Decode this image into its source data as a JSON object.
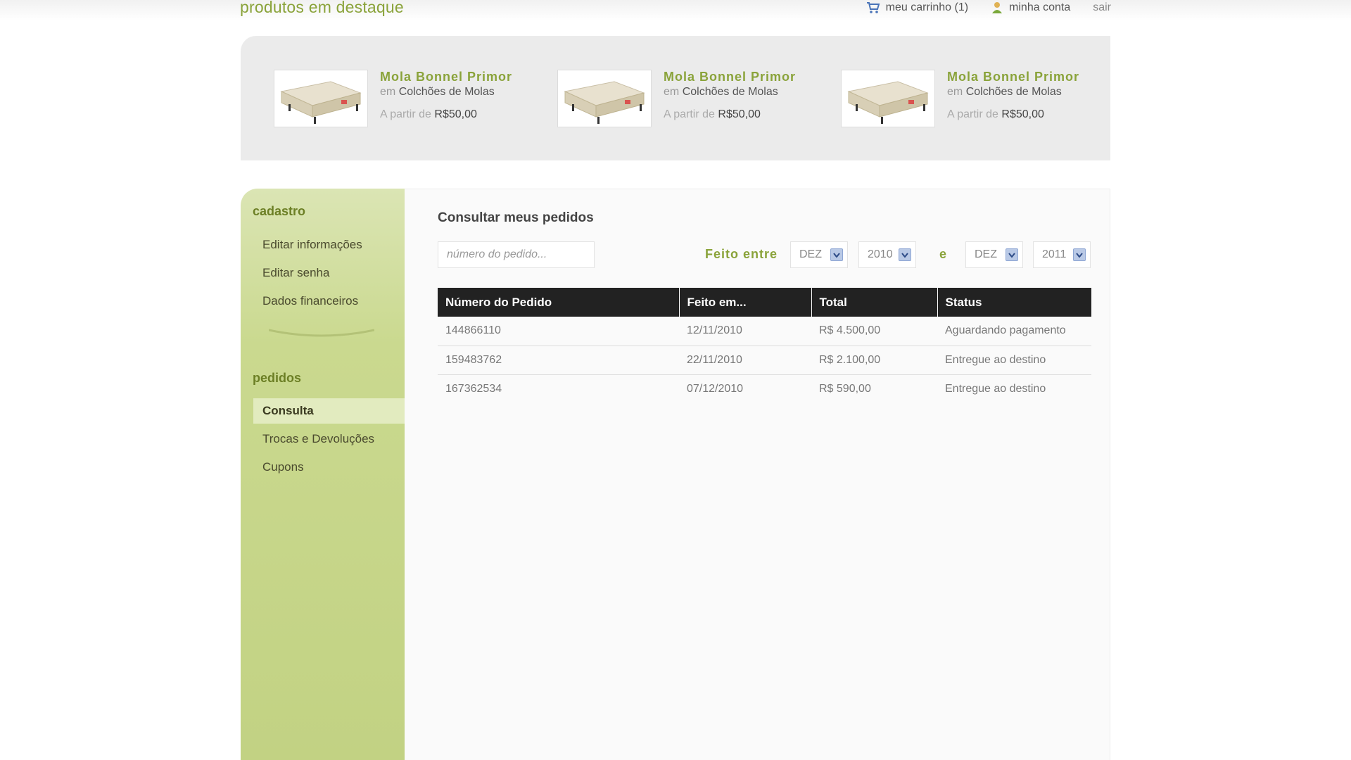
{
  "header": {
    "section_title": "produtos em destaque",
    "cart_label": "meu carrinho (1)",
    "account_label": "minha conta",
    "logout_label": "sair"
  },
  "featured": {
    "products": [
      {
        "name": "Mola Bonnel Primor",
        "cat_prefix": "em",
        "category": "Colchões de Molas",
        "price_prefix": "A partir de",
        "price": "R$50,00"
      },
      {
        "name": "Mola Bonnel Primor",
        "cat_prefix": "em",
        "category": "Colchões de Molas",
        "price_prefix": "A partir de",
        "price": "R$50,00"
      },
      {
        "name": "Mola Bonnel Primor",
        "cat_prefix": "em",
        "category": "Colchões de Molas",
        "price_prefix": "A partir de",
        "price": "R$50,00"
      }
    ]
  },
  "sidebar": {
    "cadastro_title": "cadastro",
    "cadastro_items": [
      "Editar informações",
      "Editar senha",
      "Dados financeiros"
    ],
    "pedidos_title": "pedidos",
    "pedidos_items": [
      "Consulta",
      "Trocas e Devoluções",
      "Cupons"
    ],
    "active_item": "Consulta"
  },
  "main": {
    "title": "Consultar meus pedidos",
    "search_placeholder": "número do pedido...",
    "filter_label": "Feito entre",
    "filter_connector": "e",
    "from_month": "DEZ",
    "from_year": "2010",
    "to_month": "DEZ",
    "to_year": "2011",
    "table": {
      "headers": [
        "Número do Pedido",
        "Feito em...",
        "Total",
        "Status"
      ],
      "rows": [
        [
          "144866110",
          "12/11/2010",
          "R$ 4.500,00",
          "Aguardando pagamento"
        ],
        [
          "159483762",
          "22/11/2010",
          "R$ 2.100,00",
          "Entregue ao destino"
        ],
        [
          "167362534",
          "07/12/2010",
          "R$ 590,00",
          "Entregue ao destino"
        ]
      ]
    }
  },
  "colors": {
    "accent_green": "#8aa33a",
    "sidebar_green": "#c8d78c",
    "table_header": "#222222"
  },
  "icons": [
    "cart-icon",
    "user-icon",
    "dropdown-arrow-icon"
  ]
}
